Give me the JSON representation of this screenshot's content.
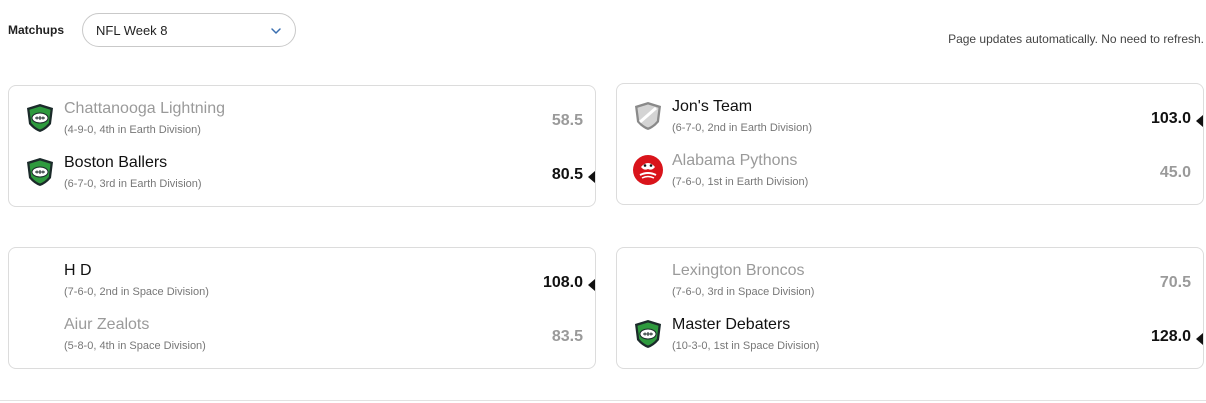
{
  "header": {
    "matchups_label": "Matchups",
    "week_selected": "NFL Week 8",
    "auto_update_note": "Page updates automatically. No need to refresh."
  },
  "matchups": [
    {
      "team1": {
        "name": "Chattanooga Lightning",
        "record": "(4-9-0, 4th in Earth Division)",
        "score": "58.5",
        "logo": "shield-icon",
        "winner": false
      },
      "team2": {
        "name": "Boston Ballers",
        "record": "(6-7-0, 3rd in Earth Division)",
        "score": "80.5",
        "logo": "shield-icon",
        "winner": true
      }
    },
    {
      "team1": {
        "name": "Jon's Team",
        "record": "(6-7-0, 2nd in Earth Division)",
        "score": "103.0",
        "logo": "gray-shield-icon",
        "winner": true
      },
      "team2": {
        "name": "Alabama Pythons",
        "record": "(7-6-0, 1st in Earth Division)",
        "score": "45.0",
        "logo": "pythons-logo-icon",
        "winner": false
      }
    },
    {
      "team1": {
        "name": "H D",
        "record": "(7-6-0, 2nd in Space Division)",
        "score": "108.0",
        "logo": "",
        "winner": true
      },
      "team2": {
        "name": "Aiur Zealots",
        "record": "(5-8-0, 4th in Space Division)",
        "score": "83.5",
        "logo": "",
        "winner": false
      }
    },
    {
      "team1": {
        "name": "Lexington Broncos",
        "record": "(7-6-0, 3rd in Space Division)",
        "score": "70.5",
        "logo": "",
        "winner": false
      },
      "team2": {
        "name": "Master Debaters",
        "record": "(10-3-0, 1st in Space Division)",
        "score": "128.0",
        "logo": "shield-icon",
        "winner": true
      }
    }
  ],
  "colors": {
    "shield_green": "#2e9a3e",
    "shield_dark": "#1b2a2a",
    "winner_text": "#111111",
    "loser_text": "#9a9a9a",
    "pythons_red": "#d9141b"
  }
}
